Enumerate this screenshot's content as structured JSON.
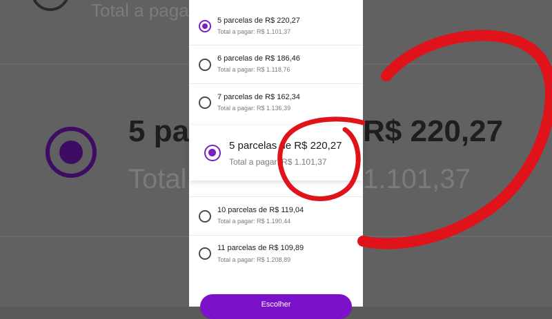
{
  "background": {
    "top_text": "Total a pagar",
    "selected_title": "5 parcelas de R$ 220,27",
    "selected_title_left": "5 pa",
    "selected_title_right": "R$ 220,27",
    "selected_sub_left": "Total",
    "selected_sub_right": "1.101,37"
  },
  "options": [
    {
      "title": "5 parcelas de R$ 220,27",
      "sub": "Total a pagar: R$ 1.101,37",
      "selected": true
    },
    {
      "title": "6 parcelas de R$ 186,46",
      "sub": "Total a pagar: R$ 1.118,76",
      "selected": false
    },
    {
      "title": "7 parcelas de R$ 162,34",
      "sub": "Total a pagar: R$ 1.136,39",
      "selected": false
    },
    {
      "title": "10 parcelas de R$ 119,04",
      "sub": "Total a pagar: R$ 1.190,44",
      "selected": false
    },
    {
      "title": "11 parcelas de R$ 109,89",
      "sub": "Total a pagar: R$ 1.208,89",
      "selected": false
    }
  ],
  "zoom": {
    "title": "5 parcelas de R$ 220,27",
    "sub": "Total a pagar: R$ 1.101,37"
  },
  "button_label": "Escolher",
  "colors": {
    "accent": "#7b1fc2",
    "annotation": "#e0121a"
  }
}
